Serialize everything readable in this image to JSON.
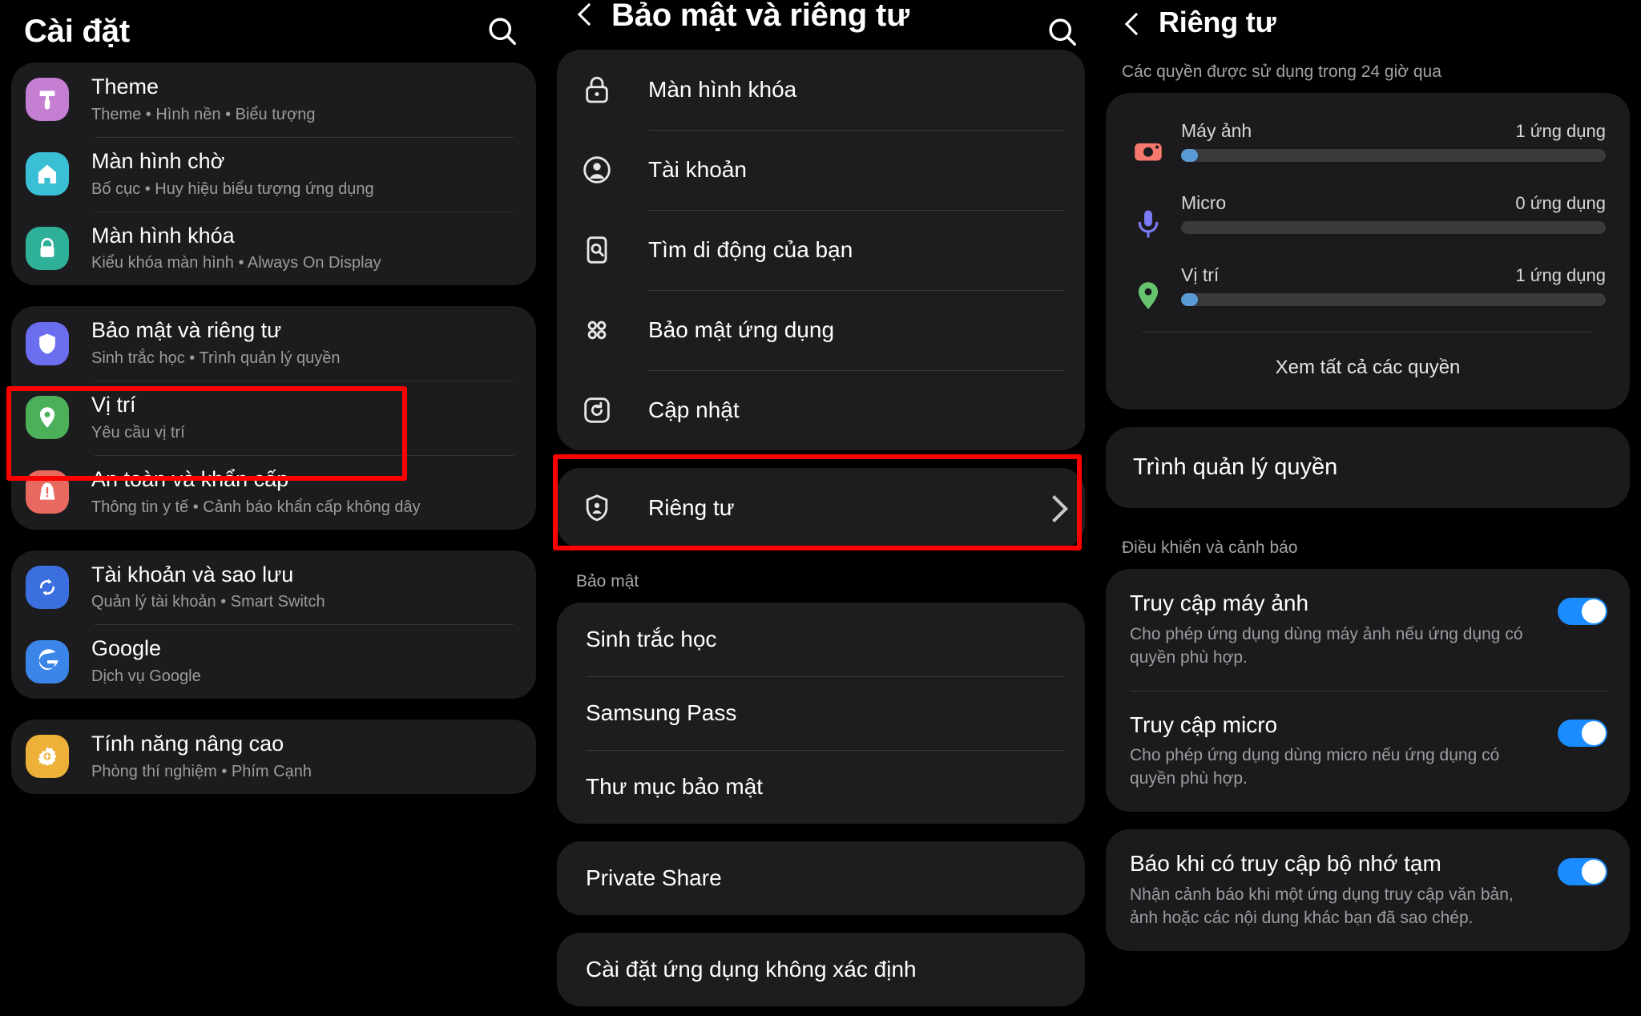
{
  "left": {
    "header": {
      "title": "Cài đặt",
      "search_icon": "search-icon"
    },
    "groups": [
      {
        "items": [
          {
            "title": "Theme",
            "sub": "Theme  •  Hình nền  •  Biểu tượng",
            "icon": "theme-brush-icon",
            "color": "#c47fd3"
          },
          {
            "title": "Màn hình chờ",
            "sub": "Bố cục  •  Huy hiệu biểu tượng ứng dụng",
            "icon": "home-icon",
            "color": "#3bbfd6"
          },
          {
            "title": "Màn hình khóa",
            "sub": "Kiểu khóa màn hình  •  Always On Display",
            "icon": "lock-icon",
            "color": "#2eb099"
          }
        ]
      },
      {
        "items": [
          {
            "title": "Bảo mật và riêng tư",
            "sub": "Sinh trắc học  •  Trình quản lý quyền",
            "icon": "shield-icon",
            "color": "#6c6ef0",
            "highlighted": true
          },
          {
            "title": "Vị trí",
            "sub": "Yêu cầu vị trí",
            "icon": "location-pin-icon",
            "color": "#4cb05a"
          },
          {
            "title": "An toàn và khẩn cấp",
            "sub": "Thông tin y tế  •  Cảnh báo khẩn cấp không dây",
            "icon": "emergency-icon",
            "color": "#e8695f"
          }
        ]
      },
      {
        "items": [
          {
            "title": "Tài khoản và sao lưu",
            "sub": "Quản lý tài khoản  •  Smart Switch",
            "icon": "sync-icon",
            "color": "#3b6fe0"
          },
          {
            "title": "Google",
            "sub": "Dịch vụ Google",
            "icon": "google-icon",
            "color": "#3b85e8"
          }
        ]
      },
      {
        "items": [
          {
            "title": "Tính năng nâng cao",
            "sub": "Phòng thí nghiệm  •  Phím Cạnh",
            "icon": "advanced-gear-icon",
            "color": "#edb13a"
          }
        ]
      }
    ]
  },
  "middle": {
    "header": {
      "title": "Bảo mật và riêng tư",
      "back_icon": "back-chevron-icon",
      "search_icon": "search-icon"
    },
    "main_items": [
      {
        "label": "Màn hình khóa",
        "icon": "lock-outline-icon"
      },
      {
        "label": "Tài khoản",
        "icon": "account-circle-icon"
      },
      {
        "label": "Tìm di động của bạn",
        "icon": "find-my-mobile-icon"
      },
      {
        "label": "Bảo mật ứng dụng",
        "icon": "app-grid-icon"
      },
      {
        "label": "Cập nhật",
        "icon": "update-icon"
      }
    ],
    "privacy_item": {
      "label": "Riêng tư",
      "icon": "privacy-shield-icon",
      "chevron": "chevron-right-icon",
      "highlighted": true
    },
    "section_security_label": "Bảo mật",
    "security_items": [
      "Sinh trắc học",
      "Samsung Pass",
      "Thư mục bảo mật"
    ],
    "private_share": "Private Share",
    "unknown_apps": "Cài đặt ứng dụng không xác định"
  },
  "right": {
    "header": {
      "title": "Riêng tư",
      "back_icon": "back-chevron-icon"
    },
    "permissions_label": "Các quyền được sử dụng trong 24 giờ qua",
    "permissions": [
      {
        "name": "Máy ảnh",
        "count": "1 ứng dụng",
        "fill_percent": 4,
        "icon": "camera-icon",
        "color": "#f4786e"
      },
      {
        "name": "Micro",
        "count": "0 ứng dụng",
        "fill_percent": 0,
        "icon": "microphone-icon",
        "color": "#7b7bf5"
      },
      {
        "name": "Vị trí",
        "count": "1 ứng dụng",
        "fill_percent": 4,
        "icon": "location-pin-icon",
        "color": "#68c36f"
      }
    ],
    "view_all": "Xem tất cả các quyền",
    "permission_manager": "Trình quản lý quyền",
    "controls_label": "Điều khiển và cảnh báo",
    "toggles": [
      {
        "title": "Truy cập máy ảnh",
        "desc": "Cho phép ứng dụng dùng máy ảnh nếu ứng dụng có quyền phù hợp.",
        "on": true
      },
      {
        "title": "Truy cập micro",
        "desc": "Cho phép ứng dụng dùng micro nếu ứng dụng có quyền phù hợp.",
        "on": true
      },
      {
        "title": "Báo khi có truy cập bộ nhớ tạm",
        "desc": "Nhận cảnh báo khi một ứng dụng truy cập văn bản, ảnh hoặc các nội dung khác bạn đã sao chép.",
        "on": true
      }
    ]
  },
  "accent": {
    "highlight_box": "#ff0000",
    "switch_on": "#1a8cff",
    "bar_fill": "#5b9bd5"
  }
}
